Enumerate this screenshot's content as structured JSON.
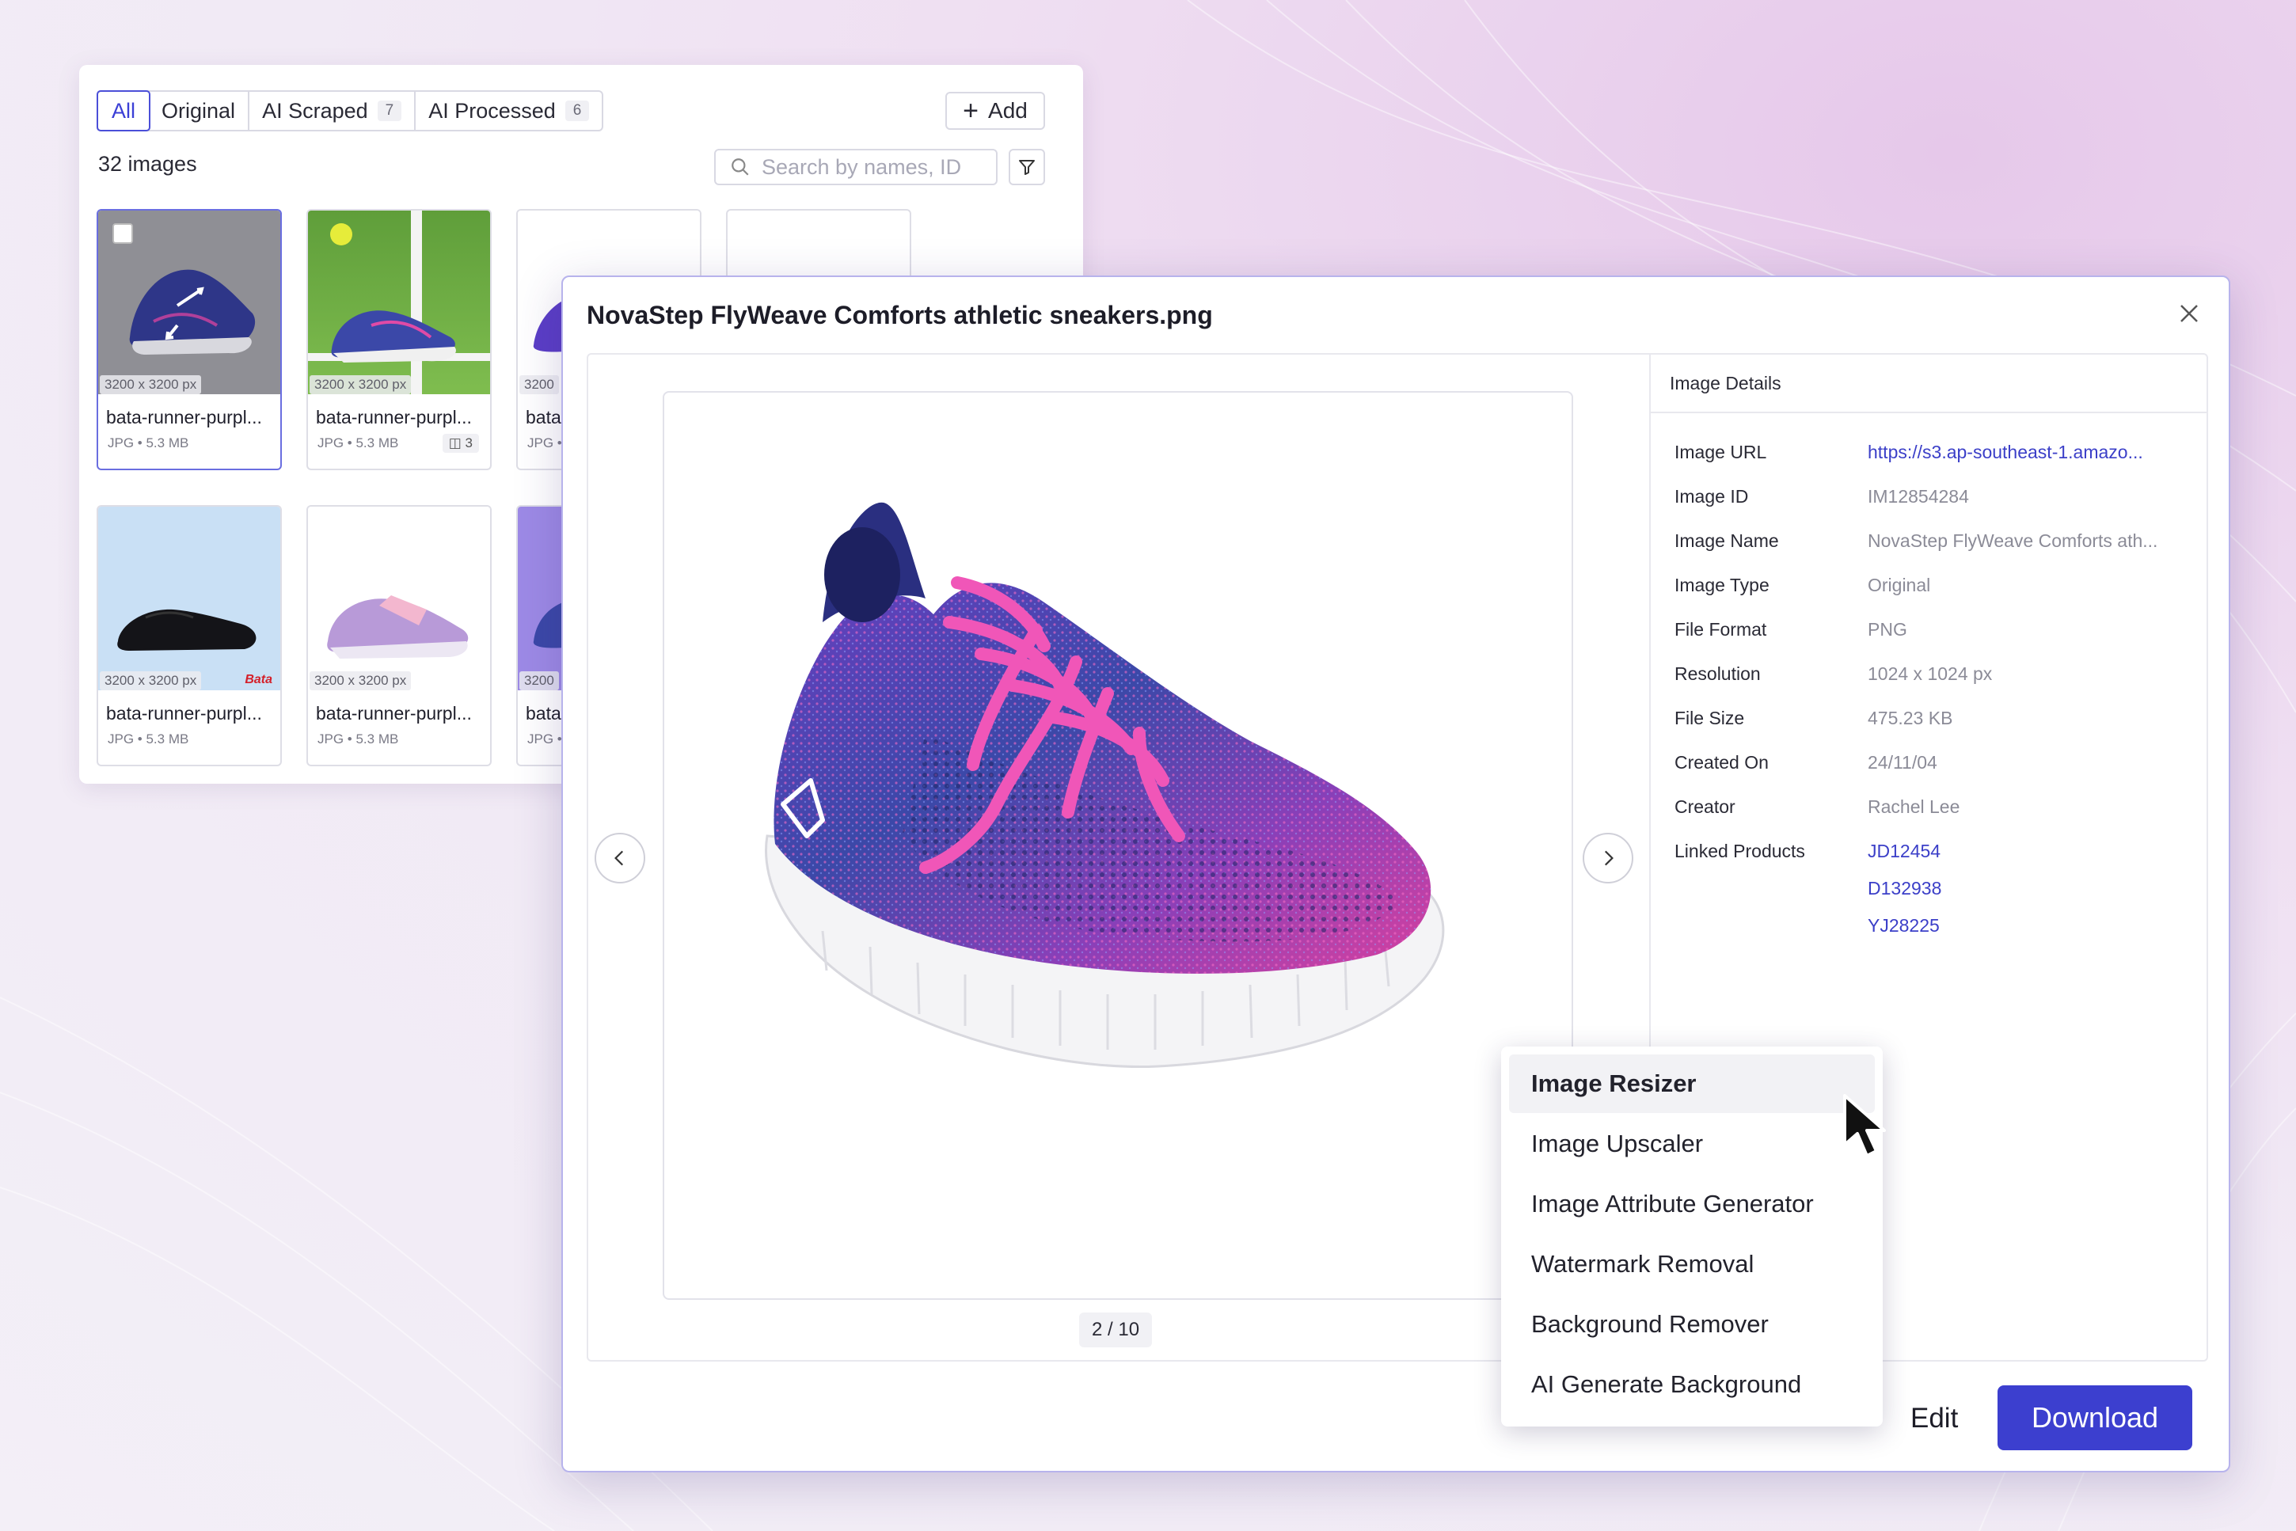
{
  "gallery": {
    "tabs": [
      {
        "label": "All",
        "count": ""
      },
      {
        "label": "Original",
        "count": ""
      },
      {
        "label": "AI Scraped",
        "count": "7"
      },
      {
        "label": "AI Processed",
        "count": "6"
      }
    ],
    "add_label": "Add",
    "image_count": "32 images",
    "search_placeholder": "Search by names, ID",
    "cards": [
      {
        "dims": "3200 x 3200 px",
        "name": "bata-runner-purpl...",
        "meta": "JPG • 5.3 MB",
        "variants": ""
      },
      {
        "dims": "3200 x 3200 px",
        "name": "bata-runner-purpl...",
        "meta": "JPG • 5.3 MB",
        "variants": "3"
      },
      {
        "dims": "3200",
        "name": "bata",
        "meta": "JPG •",
        "variants": ""
      },
      {
        "dims": "3200 x 3200 px",
        "name": "bata-runner-purpl...",
        "meta": "JPG • 5.3 MB",
        "variants": ""
      },
      {
        "dims": "3200 x 3200 px",
        "name": "bata-runner-purpl...",
        "meta": "JPG • 5.3 MB",
        "variants": ""
      },
      {
        "dims": "3200",
        "name": "bata",
        "meta": "JPG •",
        "variants": ""
      }
    ],
    "brand_watermark": "Bata"
  },
  "modal": {
    "title": "NovaStep FlyWeave Comforts athletic sneakers.png",
    "page_indicator": "2 / 10",
    "edit_label": "Edit",
    "download_label": "Download"
  },
  "details": {
    "heading": "Image Details",
    "rows": [
      {
        "label": "Image URL",
        "value": "https://s3.ap-southeast-1.amazo..."
      },
      {
        "label": "Image ID",
        "value": "IM12854284"
      },
      {
        "label": "Image Name",
        "value": "NovaStep FlyWeave Comforts ath..."
      },
      {
        "label": "Image Type",
        "value": "Original"
      },
      {
        "label": "File Format",
        "value": "PNG"
      },
      {
        "label": "Resolution",
        "value": "1024 x 1024 px"
      },
      {
        "label": "File Size",
        "value": "475.23 KB"
      },
      {
        "label": "Created On",
        "value": "24/11/04"
      },
      {
        "label": "Creator",
        "value": "Rachel Lee"
      }
    ],
    "linked_label": "Linked Products",
    "linked_products": [
      "JD12454",
      "D132938",
      "YJ28225"
    ]
  },
  "menu": {
    "items": [
      "Image Resizer",
      "Image Upscaler",
      "Image Attribute Generator",
      "Watermark Removal",
      "Background Remover",
      "AI Generate Background"
    ]
  },
  "colors": {
    "accent": "#3c3fcf",
    "link": "#3b3fc8",
    "shoe_blue": "#3b48a8",
    "shoe_pink": "#e04aa6"
  }
}
